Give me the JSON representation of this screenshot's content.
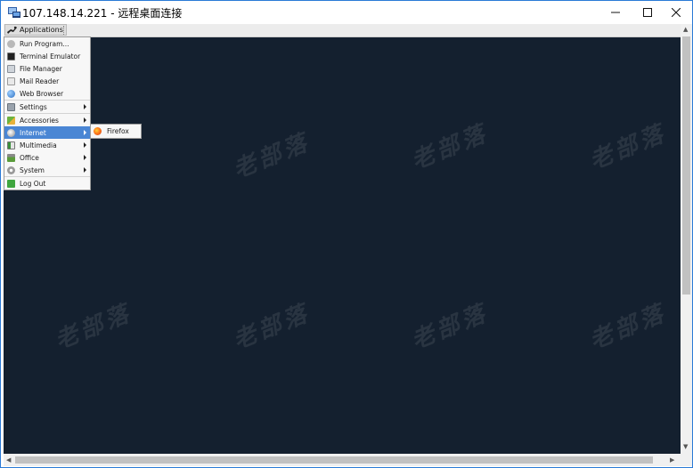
{
  "window": {
    "title": "107.148.14.221 - 远程桌面连接",
    "buttons": {
      "minimize": "—",
      "maximize": "☐",
      "close": "✕"
    }
  },
  "panel": {
    "applications_label": "Applications"
  },
  "menu": {
    "items": [
      {
        "label": "Run Program...",
        "icon": "run-icon",
        "submenu": false
      },
      {
        "label": "Terminal Emulator",
        "icon": "terminal-icon",
        "submenu": false
      },
      {
        "label": "File Manager",
        "icon": "folder-icon",
        "submenu": false
      },
      {
        "label": "Mail Reader",
        "icon": "mail-icon",
        "submenu": false
      },
      {
        "label": "Web Browser",
        "icon": "globe-icon",
        "submenu": false
      },
      {
        "label": "Settings",
        "icon": "settings-icon",
        "submenu": true
      },
      {
        "label": "Accessories",
        "icon": "accessories-icon",
        "submenu": true
      },
      {
        "label": "Internet",
        "icon": "internet-icon",
        "submenu": true,
        "active": true
      },
      {
        "label": "Multimedia",
        "icon": "multimedia-icon",
        "submenu": true
      },
      {
        "label": "Office",
        "icon": "office-icon",
        "submenu": true
      },
      {
        "label": "System",
        "icon": "system-icon",
        "submenu": true
      },
      {
        "label": "Log Out",
        "icon": "logout-icon",
        "submenu": false
      }
    ]
  },
  "submenu": {
    "items": [
      {
        "label": "Firefox",
        "icon": "firefox-icon"
      }
    ]
  },
  "watermark": "老部落",
  "colors": {
    "desktop": "#14202f",
    "highlight": "#4a86d4",
    "window_border": "#2a7ad6"
  }
}
